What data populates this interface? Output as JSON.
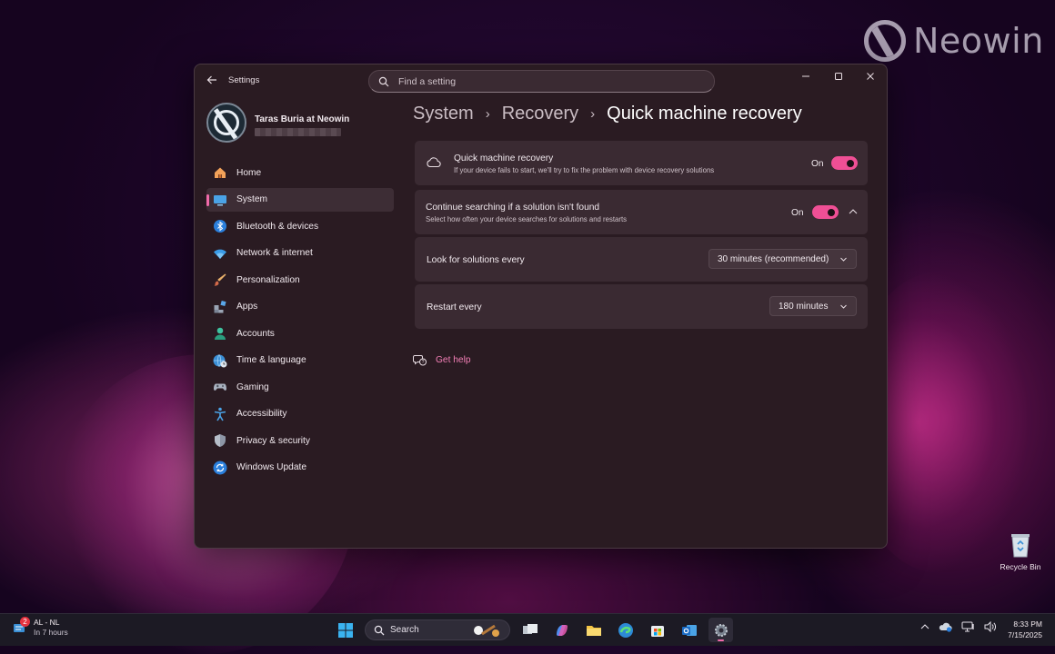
{
  "watermark": {
    "text": "Neowin"
  },
  "window": {
    "app_title": "Settings",
    "search_placeholder": "Find a setting"
  },
  "profile": {
    "name": "Taras Buria at Neowin"
  },
  "sidebar": {
    "items": [
      {
        "label": "Home",
        "icon": "home-icon"
      },
      {
        "label": "System",
        "icon": "system-icon",
        "active": true
      },
      {
        "label": "Bluetooth & devices",
        "icon": "bluetooth-icon"
      },
      {
        "label": "Network & internet",
        "icon": "wifi-icon"
      },
      {
        "label": "Personalization",
        "icon": "brush-icon"
      },
      {
        "label": "Apps",
        "icon": "apps-icon"
      },
      {
        "label": "Accounts",
        "icon": "person-icon"
      },
      {
        "label": "Time & language",
        "icon": "globe-clock-icon"
      },
      {
        "label": "Gaming",
        "icon": "gamepad-icon"
      },
      {
        "label": "Accessibility",
        "icon": "accessibility-icon"
      },
      {
        "label": "Privacy & security",
        "icon": "shield-icon"
      },
      {
        "label": "Windows Update",
        "icon": "update-icon"
      }
    ]
  },
  "breadcrumb": {
    "level1": "System",
    "level2": "Recovery",
    "current": "Quick machine recovery"
  },
  "settings": {
    "quick_recovery": {
      "title": "Quick machine recovery",
      "description": "If your device fails to start, we'll try to fix the problem with device recovery solutions",
      "toggle_label": "On"
    },
    "continue_search": {
      "title": "Continue searching if a solution isn't found",
      "description": "Select how often your device searches for solutions and restarts",
      "toggle_label": "On"
    },
    "look_for_solutions": {
      "label": "Look for solutions every",
      "value": "30 minutes (recommended)"
    },
    "restart_every": {
      "label": "Restart every",
      "value": "180 minutes"
    }
  },
  "get_help": {
    "label": "Get help"
  },
  "desktop": {
    "recycle_bin_label": "Recycle Bin"
  },
  "taskbar": {
    "weather_badge": "2",
    "weather_title": "AL - NL",
    "weather_subtitle": "In 7 hours",
    "search_label": "Search",
    "time": "8:33 PM",
    "date": "7/15/2025"
  },
  "colors": {
    "accent": "#ef4f95",
    "link": "#f37fb6",
    "window_bg": "#2a1b22",
    "card_bg": "#3a2a32"
  }
}
